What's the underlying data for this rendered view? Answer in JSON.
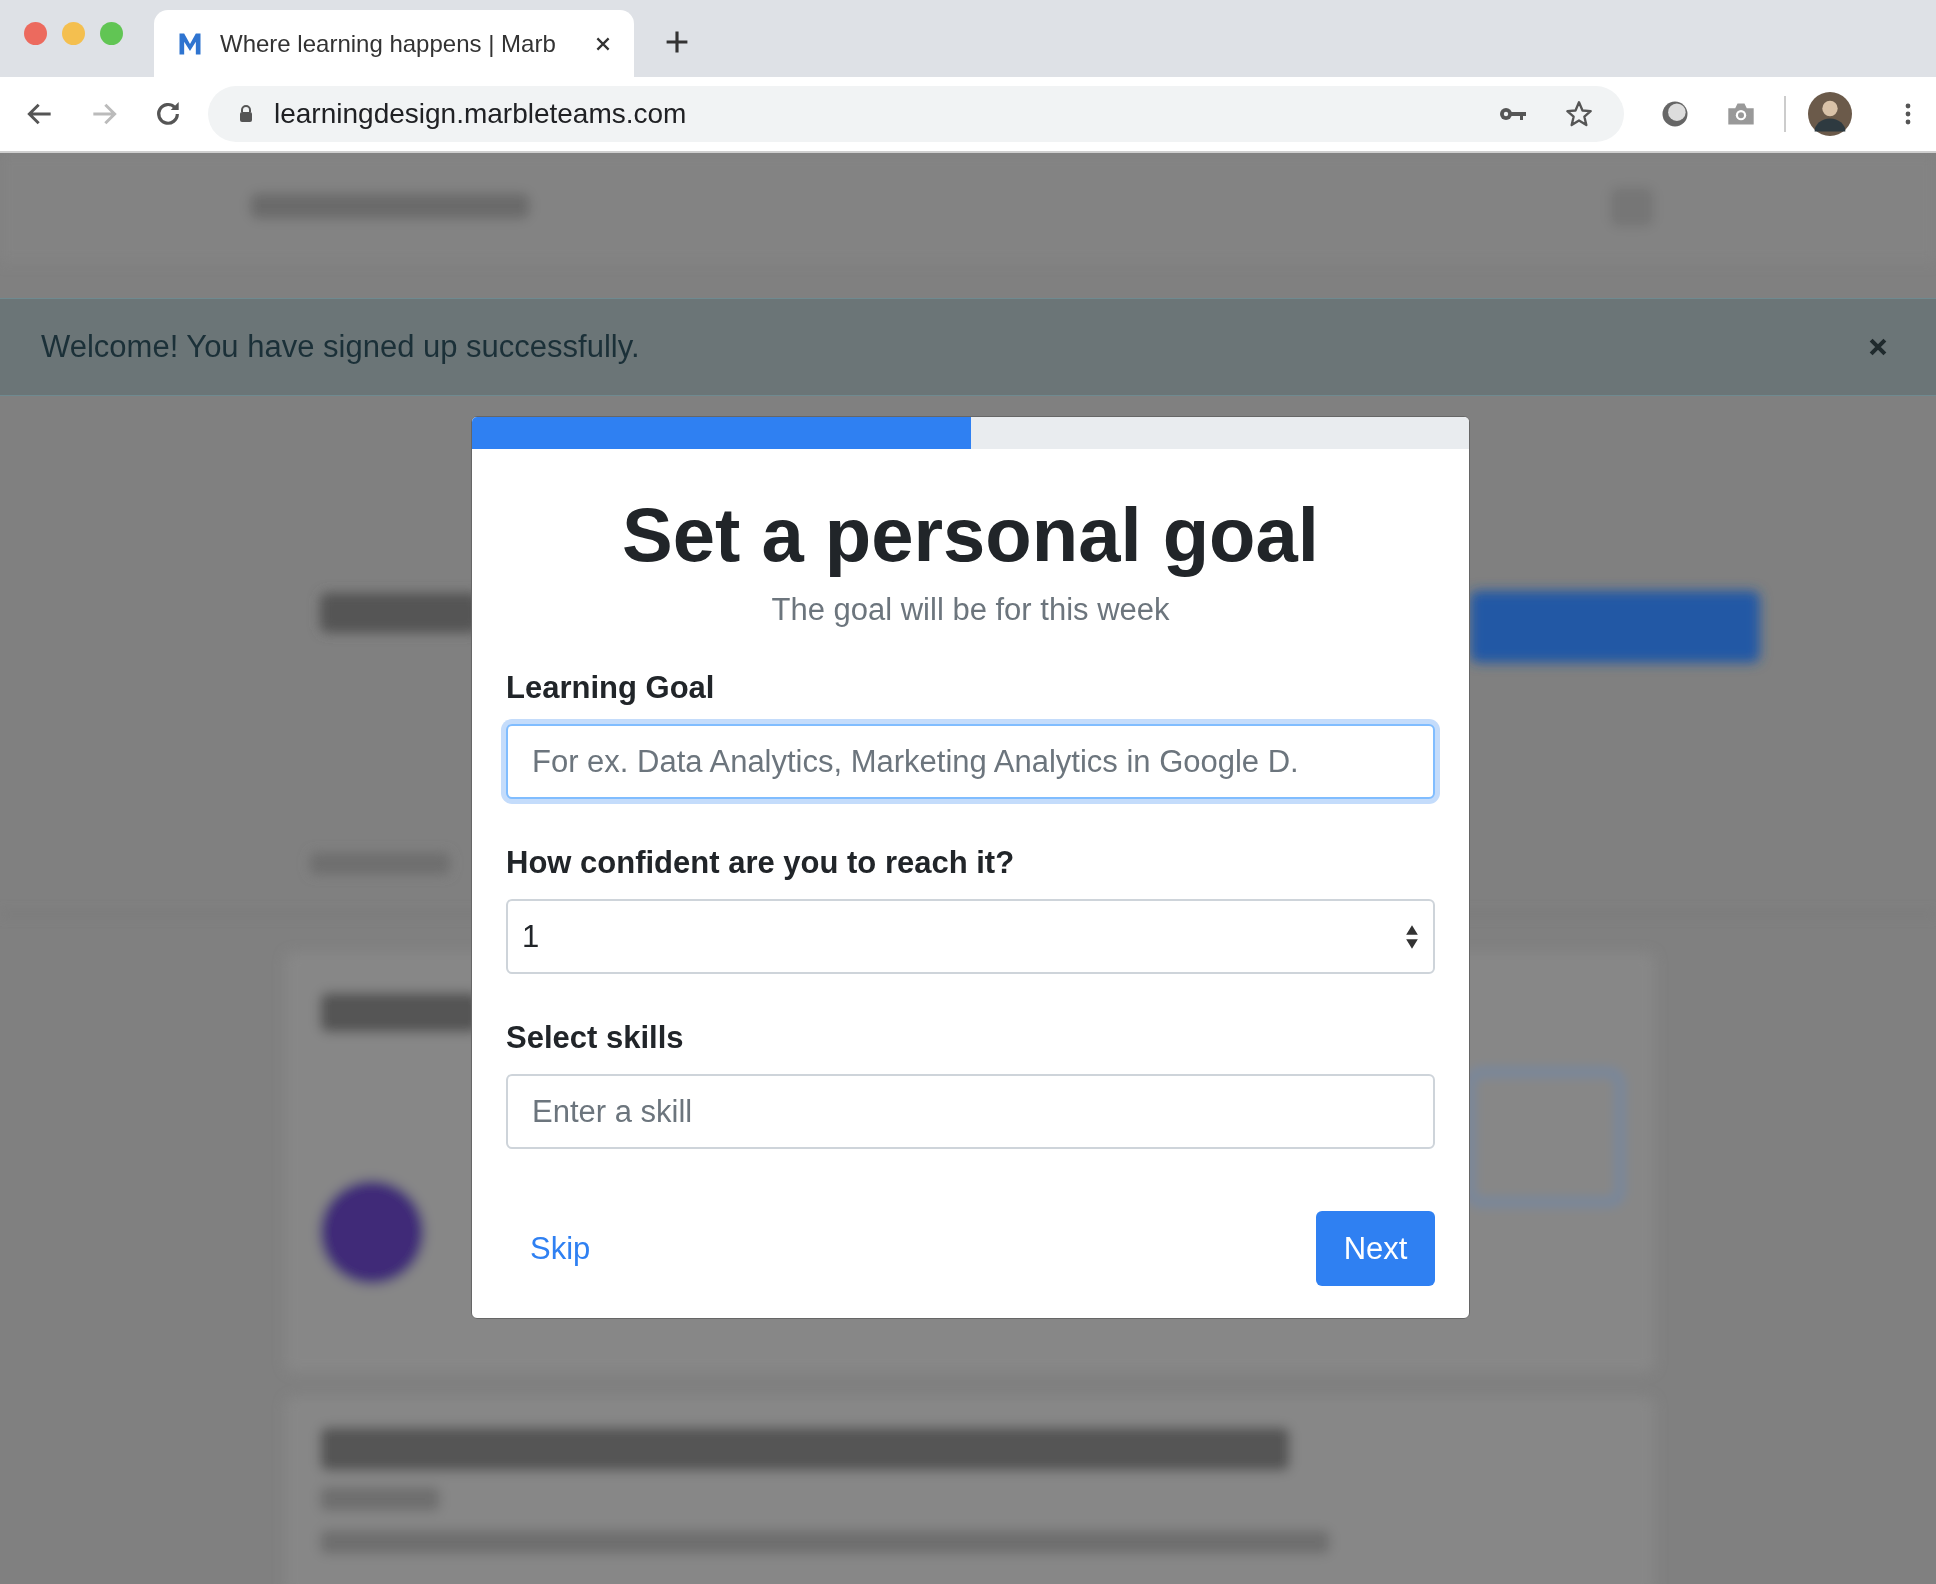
{
  "browser": {
    "tab": {
      "title": "Where learning happens | Marb",
      "selected": true
    },
    "url": "learningdesign.marbleteams.com",
    "forward_disabled": true
  },
  "alert": {
    "message": "Welcome! You have signed up successfully."
  },
  "modal": {
    "progress": {
      "level": 0.5
    },
    "title": "Set a personal goal",
    "subtitle": "The goal will be for this week",
    "fields": [
      {
        "kind": "text",
        "label": "Learning Goal",
        "placeholder": "For ex. Data Analytics, Marketing Analytics in Google D.",
        "focused": true
      },
      {
        "kind": "select",
        "label": "How confident are you to reach it?",
        "value": "1",
        "focused": false
      },
      {
        "kind": "text",
        "label": "Select skills",
        "placeholder": "Enter a skill",
        "focused": false
      }
    ],
    "skip": "Skip",
    "next": "Next"
  }
}
